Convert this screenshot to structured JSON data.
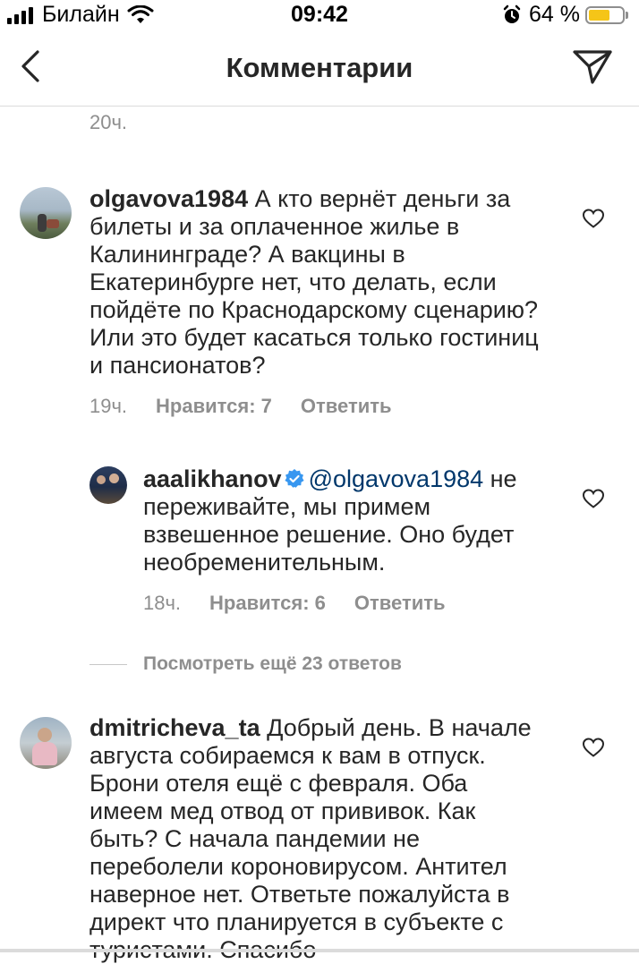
{
  "status_bar": {
    "carrier": "Билайн",
    "time": "09:42",
    "battery_percent": "64 %",
    "battery_level": 0.64
  },
  "header": {
    "title": "Комментарии"
  },
  "top_time": "20ч.",
  "comments": [
    {
      "username": "olgavova1984",
      "text": "А кто вернёт деньги за билеты и за оплаченное жилье в Калининграде?  А вакцины в Екатеринбурге нет, что делать, если пойдёте по Краснодарскому сценарию? Или это будет касаться только гостиниц и пансионатов?",
      "time": "19ч.",
      "likes": "Нравится: 7",
      "reply": "Ответить"
    },
    {
      "username": "aaalikhanov",
      "mention": "@olgavova1984",
      "text": " не переживайте, мы примем взвешенное решение. Оно будет необременительным.",
      "time": "18ч.",
      "likes": "Нравится: 6",
      "reply": "Ответить"
    },
    {
      "username": "dmitricheva_ta",
      "text": "Добрый день. В начале августа собираемся к вам в отпуск. Брони отеля ещё с февраля. Оба имеем мед отвод от прививок. Как быть? С начала пандемии не переболели короновирусом. Антител наверное нет. Ответьте пожалуйста в директ что планируется в субъекте с туристами. Спасибо"
    }
  ],
  "view_more": "Посмотреть ещё 23 ответов",
  "icons": {
    "signal": "signal-bars-icon",
    "wifi": "wifi-icon",
    "alarm": "alarm-clock-icon",
    "back": "chevron-left-icon",
    "send": "paper-plane-icon",
    "like": "heart-outline-icon",
    "verified": "verified-badge-icon"
  },
  "colors": {
    "mention": "#00376b",
    "secondary_text": "#8e8e8e",
    "battery": "#f5c518",
    "verified": "#3897f0"
  }
}
